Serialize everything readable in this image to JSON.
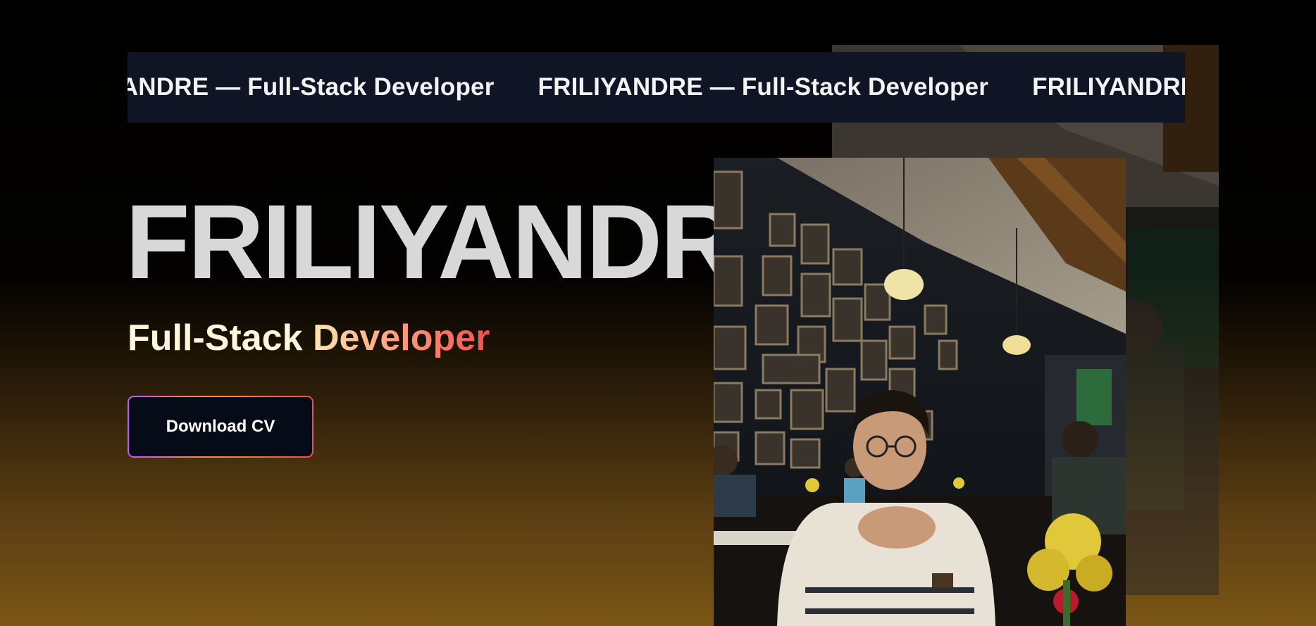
{
  "marquee": {
    "items": [
      "FRILIYANDRE — Full-Stack Developer",
      "FRILIYANDRE — Full-Stack Developer",
      "FRILIYANDRE — Full-Stack Developer"
    ]
  },
  "hero": {
    "name": "FRILIYANDRE",
    "role_first": "Full-Stack",
    "role_second": "Developer",
    "cv_button_label": "Download CV"
  },
  "colors": {
    "name_text": "#d8d8d8",
    "button_bg": "#060b18",
    "marquee_bg": "#0f1525"
  }
}
